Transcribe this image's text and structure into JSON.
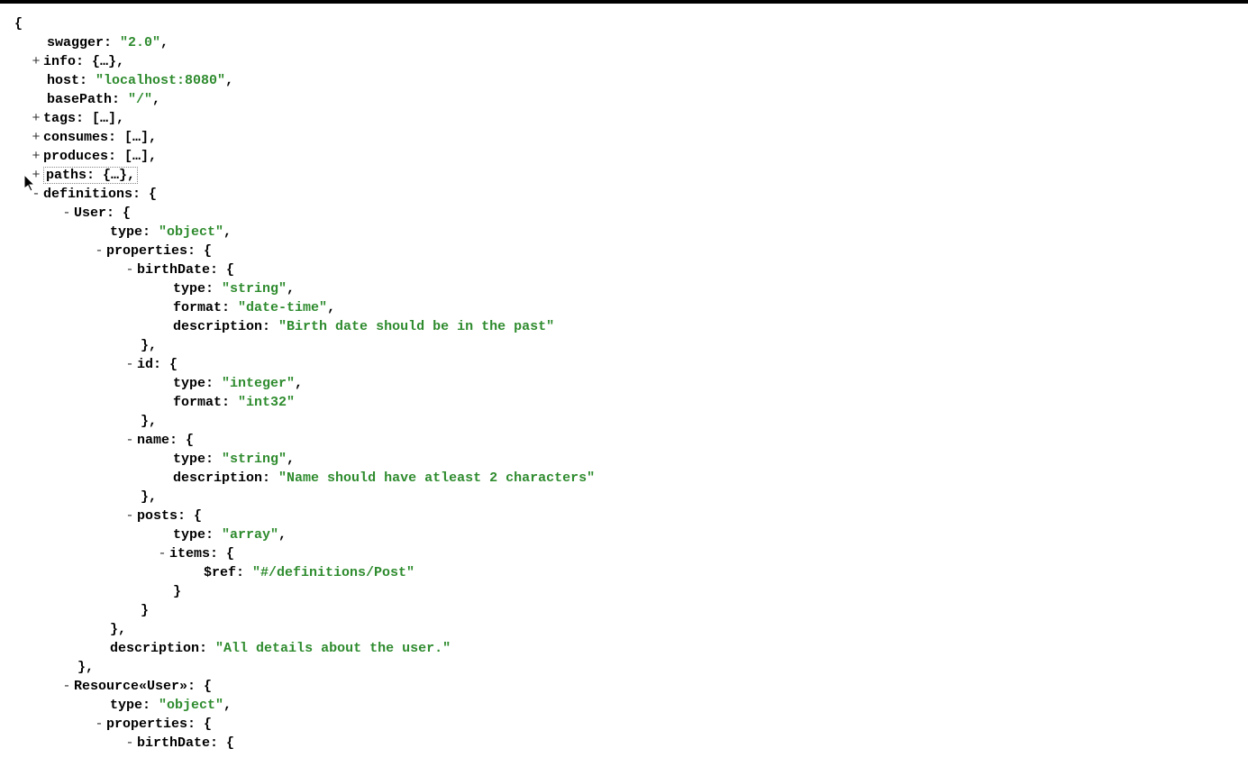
{
  "root": {
    "swagger_key": "swagger:",
    "swagger_val": "\"2.0\"",
    "info_key": "info:",
    "info_coll": "{…}",
    "host_key": "host:",
    "host_val": "\"localhost:8080\"",
    "basePath_key": "basePath:",
    "basePath_val": "\"/\"",
    "tags_key": "tags:",
    "tags_coll": "[…]",
    "consumes_key": "consumes:",
    "consumes_coll": "[…]",
    "produces_key": "produces:",
    "produces_coll": "[…]",
    "paths_key": "paths:",
    "paths_coll": "{…}",
    "definitions_key": "definitions:",
    "user_key": "User:",
    "type_key": "type:",
    "object_val": "\"object\"",
    "properties_key": "properties:",
    "birthDate_key": "birthDate:",
    "string_val": "\"string\"",
    "format_key": "format:",
    "datetime_val": "\"date-time\"",
    "description_key": "description:",
    "birthDate_desc": "\"Birth date should be in the past\"",
    "id_key": "id:",
    "integer_val": "\"integer\"",
    "int32_val": "\"int32\"",
    "name_key": "name:",
    "name_desc": "\"Name should have atleast 2 characters\"",
    "posts_key": "posts:",
    "array_val": "\"array\"",
    "items_key": "items:",
    "ref_key": "$ref:",
    "ref_val": "\"#/definitions/Post\"",
    "user_desc": "\"All details about the user.\"",
    "resourceUser_key": "Resource«User»:",
    "open_brace": "{",
    "close_brace": "}",
    "close_brace_comma": "},",
    "close_brace_obj": "}",
    "comma": ","
  },
  "toggles": {
    "plus": "+",
    "minus": "-"
  }
}
